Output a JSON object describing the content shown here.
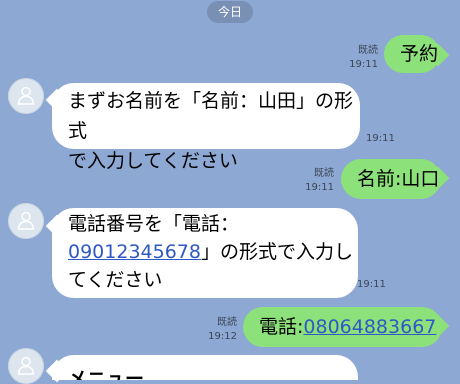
{
  "date_label": "今日",
  "messages": [
    {
      "dir": "out",
      "text": "予約",
      "read": "既読",
      "time": "19:11"
    },
    {
      "dir": "in",
      "lines": [
        "まずお名前を「名前：山田」の形式",
        "で入力してください"
      ],
      "time": "19:11"
    },
    {
      "dir": "out",
      "text": "名前:山口",
      "read": "既読",
      "time": "19:11"
    },
    {
      "dir": "in",
      "line1": "電話番号を「電話：",
      "link": "09012345678",
      "line2_after": "」の形式で入力し",
      "line3": "てください",
      "time": "19:11"
    },
    {
      "dir": "out",
      "prefix": "電話:",
      "link": "08064883667",
      "read": "既読",
      "time": "19:12"
    },
    {
      "dir": "in",
      "text": "メニュー"
    }
  ],
  "icons": {
    "avatar": "default-user-avatar-icon"
  }
}
